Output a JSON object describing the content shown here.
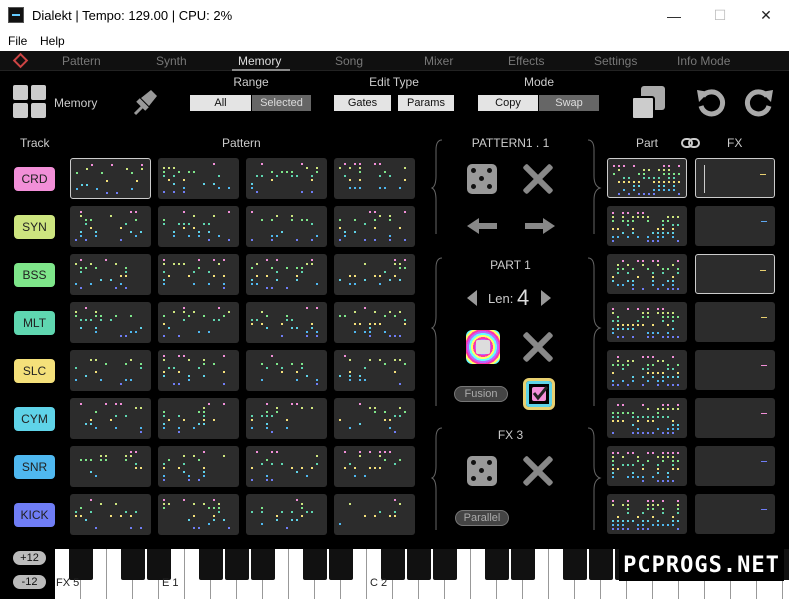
{
  "window": {
    "title": "Dialekt | Tempo: 129.00 | CPU: 2%",
    "controls": [
      "—",
      "☐",
      "✕"
    ]
  },
  "menu": [
    "File",
    "Help"
  ],
  "nav": {
    "items": [
      "Pattern",
      "Synth",
      "Memory",
      "Song",
      "Mixer",
      "Effects",
      "Settings",
      "Info Mode"
    ],
    "active": "Memory"
  },
  "toolbar": {
    "memory_label": "Memory",
    "range_label": "Range",
    "range_options": [
      "All",
      "Selected"
    ],
    "edit_type_label": "Edit Type",
    "edit_type_options": [
      "Gates",
      "Params"
    ],
    "mode_label": "Mode",
    "mode_options": [
      "Copy",
      "Swap"
    ]
  },
  "columns": {
    "track": "Track",
    "pattern": "Pattern",
    "part": "Part",
    "fx": "FX"
  },
  "tracks": [
    {
      "name": "CRD",
      "color": "#f28fd8"
    },
    {
      "name": "SYN",
      "color": "#cde57f"
    },
    {
      "name": "BSS",
      "color": "#7ee68a"
    },
    {
      "name": "MLT",
      "color": "#5fd6b0"
    },
    {
      "name": "SLC",
      "color": "#f4e07a"
    },
    {
      "name": "CYM",
      "color": "#5fd3e8"
    },
    {
      "name": "SNR",
      "color": "#4fb8f0"
    },
    {
      "name": "KICK",
      "color": "#6f7df5"
    }
  ],
  "pattern_panel": {
    "title": "PATTERN1 . 1"
  },
  "part_panel": {
    "title": "PART  1",
    "len_label": "Len:",
    "len_value": "4",
    "fusion_label": "Fusion"
  },
  "fx_panel": {
    "title": "FX  3",
    "parallel_label": "Parallel"
  },
  "fx_tick_colors": [
    "#e8d070",
    "#5fa8f0",
    "#e8d070",
    "#e8d070",
    "#f28fd8",
    "#f28fd8",
    "#6f7df5",
    "#6f7df5"
  ],
  "keyboard": {
    "octave_up": "+12",
    "octave_down": "-12",
    "labels": [
      "FX 5",
      "E 1",
      "C 2"
    ]
  },
  "watermark": "PCPROGS.NET"
}
